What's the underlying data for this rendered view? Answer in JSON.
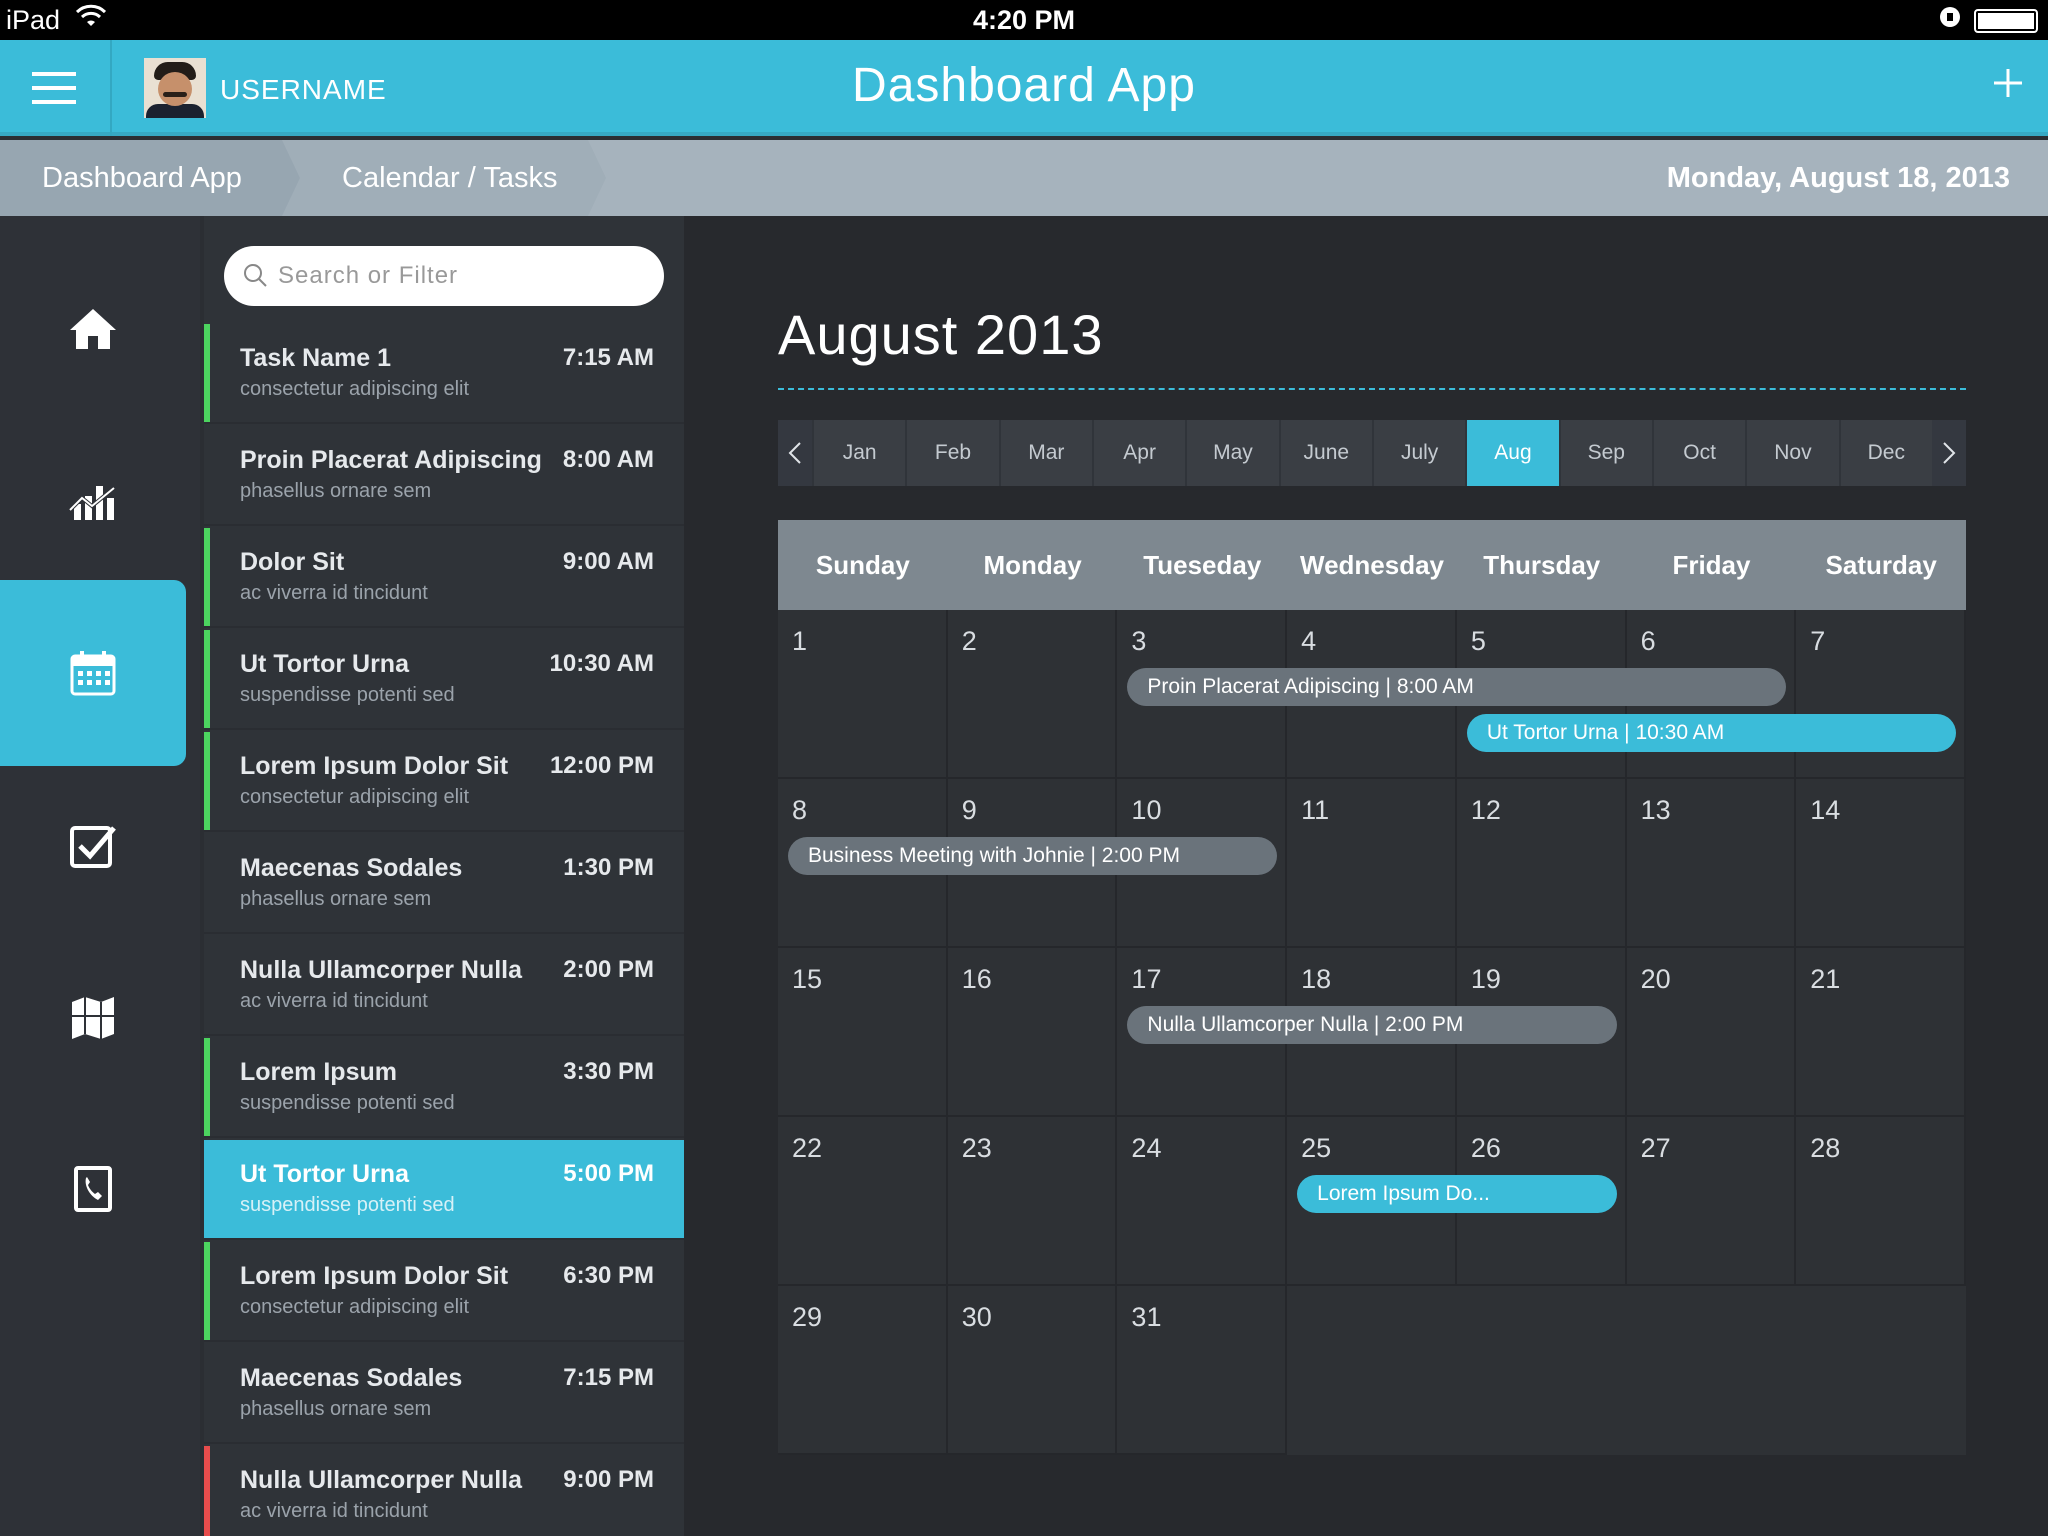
{
  "status": {
    "carrier": "iPad",
    "time": "4:20 PM"
  },
  "header": {
    "username": "USERNAME",
    "title": "Dashboard App"
  },
  "breadcrumb": {
    "items": [
      "Dashboard App",
      "Calendar / Tasks"
    ],
    "date": "Monday, August 18, 2013"
  },
  "nav": {
    "items": [
      "home-icon",
      "chart-icon",
      "calendar-icon",
      "checkbox-icon",
      "map-icon",
      "phone-book-icon"
    ],
    "active_index": 2
  },
  "search": {
    "placeholder": "Search or Filter"
  },
  "tasks": [
    {
      "name": "Task Name 1",
      "sub": "consectetur adipiscing elit",
      "time": "7:15 AM",
      "marker": "green"
    },
    {
      "name": "Proin Placerat Adipiscing",
      "sub": "phasellus ornare sem",
      "time": "8:00 AM",
      "marker": "none"
    },
    {
      "name": "Dolor Sit",
      "sub": "ac viverra id tincidunt",
      "time": "9:00 AM",
      "marker": "green"
    },
    {
      "name": "Ut Tortor Urna",
      "sub": "suspendisse potenti sed",
      "time": "10:30 AM",
      "marker": "green"
    },
    {
      "name": "Lorem Ipsum Dolor Sit",
      "sub": "consectetur adipiscing elit",
      "time": "12:00 PM",
      "marker": "green"
    },
    {
      "name": "Maecenas Sodales",
      "sub": "phasellus ornare sem",
      "time": "1:30 PM",
      "marker": "none"
    },
    {
      "name": "Nulla Ullamcorper Nulla",
      "sub": "ac viverra id tincidunt",
      "time": "2:00 PM",
      "marker": "none"
    },
    {
      "name": "Lorem Ipsum",
      "sub": "suspendisse potenti sed",
      "time": "3:30 PM",
      "marker": "green"
    },
    {
      "name": "Ut Tortor Urna",
      "sub": "suspendisse potenti sed",
      "time": "5:00 PM",
      "marker": "selected"
    },
    {
      "name": "Lorem Ipsum Dolor Sit",
      "sub": "consectetur adipiscing elit",
      "time": "6:30 PM",
      "marker": "green"
    },
    {
      "name": "Maecenas Sodales",
      "sub": "phasellus ornare sem",
      "time": "7:15 PM",
      "marker": "none"
    },
    {
      "name": "Nulla Ullamcorper Nulla",
      "sub": "ac viverra id tincidunt",
      "time": "9:00 PM",
      "marker": "red"
    }
  ],
  "calendar": {
    "title": "August 2013",
    "months": [
      "Jan",
      "Feb",
      "Mar",
      "Apr",
      "May",
      "June",
      "July",
      "Aug",
      "Sep",
      "Oct",
      "Nov",
      "Dec"
    ],
    "active_month": "Aug",
    "weekdays": [
      "Sunday",
      "Monday",
      "Tueseday",
      "Wednesday",
      "Thursday",
      "Friday",
      "Saturday"
    ],
    "first_weekday_index": 0,
    "days_in_month": 31,
    "events": [
      {
        "label": "Proin Placerat Adipiscing | 8:00 AM",
        "start": 3,
        "end": 6,
        "color": "gray"
      },
      {
        "label": "Ut Tortor Urna | 10:30 AM",
        "start": 5,
        "end": 7,
        "color": "blue"
      },
      {
        "label": "Business Meeting with Johnie | 2:00 PM",
        "start": 8,
        "end": 10,
        "color": "gray"
      },
      {
        "label": "Nulla Ullamcorper Nulla | 2:00 PM",
        "start": 17,
        "end": 19,
        "color": "gray"
      },
      {
        "label": "Lorem Ipsum Do...",
        "start": 25,
        "end": 26,
        "color": "blue"
      }
    ]
  },
  "colors": {
    "accent": "#3bbcd9",
    "green": "#4cd35f",
    "red": "#e74c4c"
  }
}
